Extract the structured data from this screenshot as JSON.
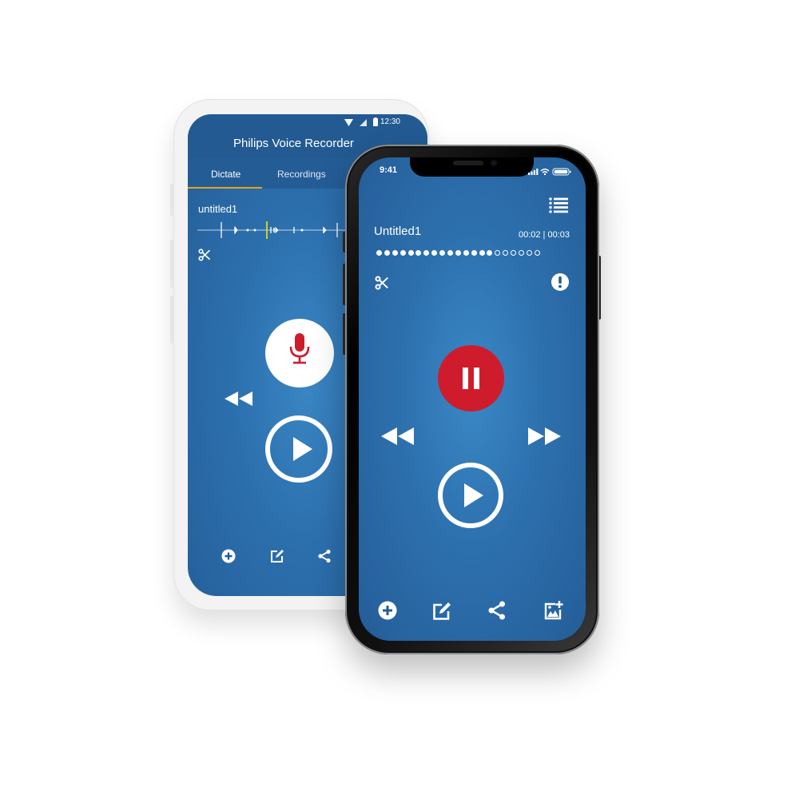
{
  "android": {
    "status_time": "12:30",
    "status_icons": [
      "wifi-icon",
      "cell-signal-icon",
      "battery-icon"
    ],
    "app_title": "Philips Voice Recorder",
    "tabs": [
      {
        "label": "Dictate",
        "active": true
      },
      {
        "label": "Recordings",
        "active": false
      }
    ],
    "accent_color": "#e8a21a",
    "recording_name": "untitled1",
    "waveform_cursor_color": "#c9d21c",
    "controls": {
      "cut": "scissors-icon",
      "record": "microphone-icon",
      "rewind": "rewind-icon",
      "play": "play-icon"
    },
    "record_icon_color": "#cf1c2c",
    "bottom_bar": [
      "add-icon",
      "edit-icon",
      "share-icon"
    ]
  },
  "iphone": {
    "status_time": "9:41",
    "status_icons": [
      "cell-signal-icon",
      "wifi-icon",
      "battery-icon"
    ],
    "menu_icon": "list-icon",
    "recording_name": "Untitled1",
    "timer": "00:02 | 00:03",
    "progress": {
      "filled": 15,
      "total": 21
    },
    "controls": {
      "cut": "scissors-icon",
      "alert": "exclamation-icon",
      "pause": "pause-icon",
      "rewind": "rewind-icon",
      "fast_forward": "fast-forward-icon",
      "play": "play-icon"
    },
    "pause_color": "#cf1c2c",
    "bottom_bar": [
      "add-icon",
      "edit-icon",
      "share-icon",
      "add-image-icon"
    ]
  }
}
